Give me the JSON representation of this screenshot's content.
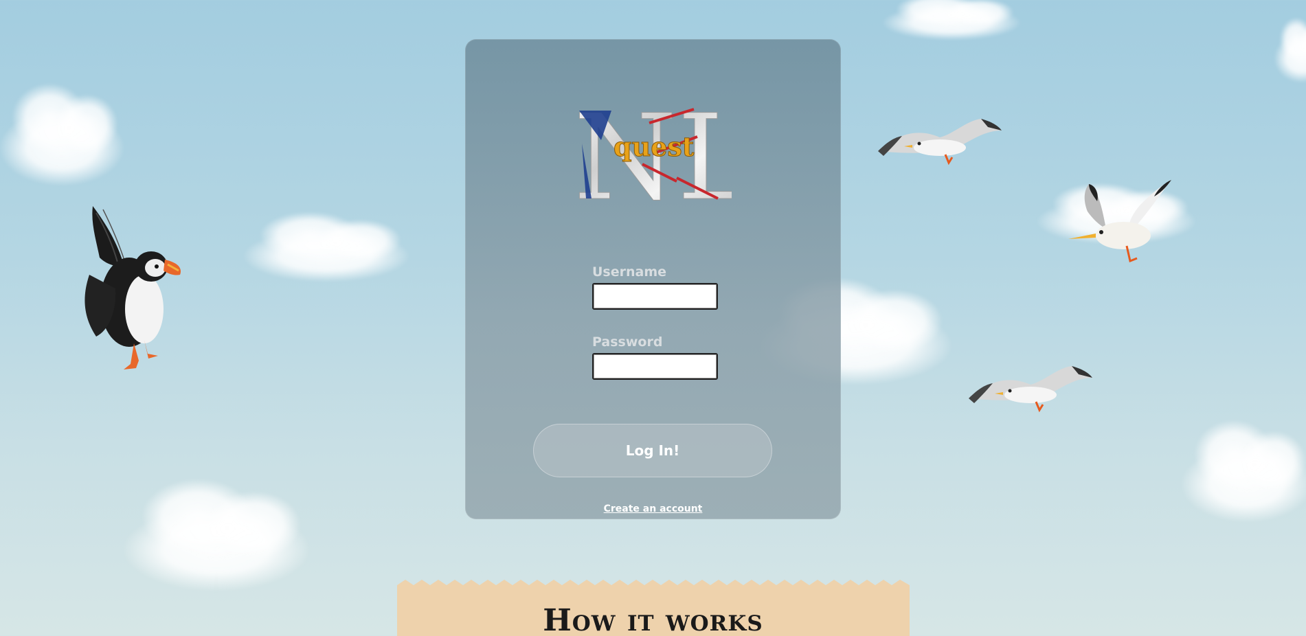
{
  "logo": {
    "main_letters": "NL",
    "sub_text": "quest"
  },
  "login_form": {
    "username_label": "Username",
    "username_value": "",
    "password_label": "Password",
    "password_value": "",
    "submit_label": "Log In!",
    "create_account_label": "Create an account"
  },
  "how_it_works": {
    "title": "How it works"
  },
  "colors": {
    "sky_top": "#a3cde0",
    "card": "#7a939f",
    "banner": "#eed2ac",
    "flag_blue": "#1f3f8f",
    "flag_red": "#c8272d",
    "flag_gold": "#e8a21a"
  },
  "illustrations": [
    "puffin-icon",
    "seagull-icon",
    "cloud-icon"
  ]
}
